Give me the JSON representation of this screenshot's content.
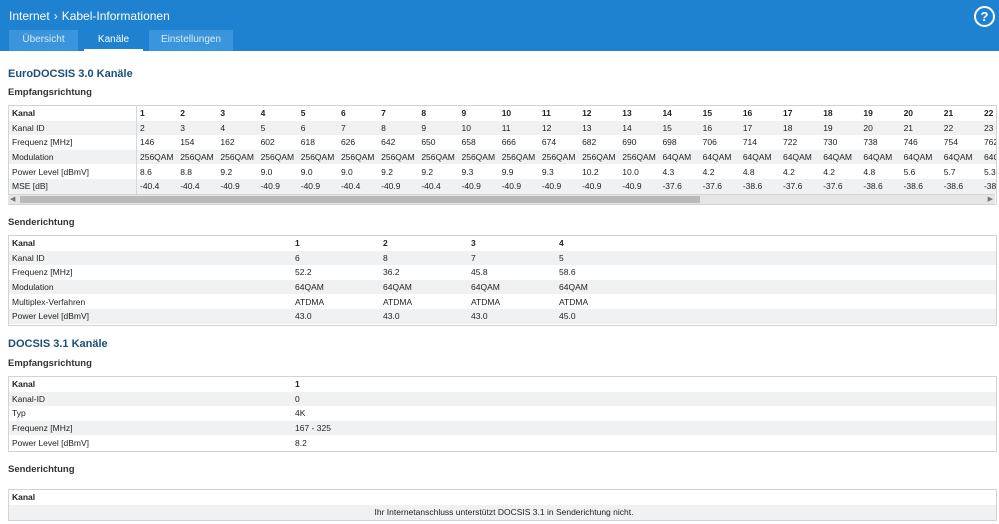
{
  "breadcrumb": {
    "root": "Internet",
    "page": "Kabel-Informationen"
  },
  "help_label": "?",
  "tabs": [
    {
      "label": "Übersicht"
    },
    {
      "label": "Kanäle"
    },
    {
      "label": "Einstellungen"
    }
  ],
  "euro30": {
    "title": "EuroDOCSIS 3.0 Kanäle",
    "down": {
      "title": "Empfangsrichtung",
      "labels": [
        "Kanal",
        "Kanal ID",
        "Frequenz [MHz]",
        "Modulation",
        "Power Level [dBmV]",
        "MSE [dB]"
      ],
      "columns": [
        [
          "1",
          "2",
          "146",
          "256QAM",
          "8.6",
          "-40.4"
        ],
        [
          "2",
          "3",
          "154",
          "256QAM",
          "8.8",
          "-40.4"
        ],
        [
          "3",
          "4",
          "162",
          "256QAM",
          "9.2",
          "-40.9"
        ],
        [
          "4",
          "5",
          "602",
          "256QAM",
          "9.0",
          "-40.9"
        ],
        [
          "5",
          "6",
          "618",
          "256QAM",
          "9.0",
          "-40.9"
        ],
        [
          "6",
          "7",
          "626",
          "256QAM",
          "9.0",
          "-40.4"
        ],
        [
          "7",
          "8",
          "642",
          "256QAM",
          "9.2",
          "-40.9"
        ],
        [
          "8",
          "9",
          "650",
          "256QAM",
          "9.2",
          "-40.4"
        ],
        [
          "9",
          "10",
          "658",
          "256QAM",
          "9.3",
          "-40.9"
        ],
        [
          "10",
          "11",
          "666",
          "256QAM",
          "9.9",
          "-40.9"
        ],
        [
          "11",
          "12",
          "674",
          "256QAM",
          "9.3",
          "-40.9"
        ],
        [
          "12",
          "13",
          "682",
          "256QAM",
          "10.2",
          "-40.9"
        ],
        [
          "13",
          "14",
          "690",
          "256QAM",
          "10.0",
          "-40.9"
        ],
        [
          "14",
          "15",
          "698",
          "64QAM",
          "4.3",
          "-37.6"
        ],
        [
          "15",
          "16",
          "706",
          "64QAM",
          "4.2",
          "-37.6"
        ],
        [
          "16",
          "17",
          "714",
          "64QAM",
          "4.8",
          "-38.6"
        ],
        [
          "17",
          "18",
          "722",
          "64QAM",
          "4.2",
          "-37.6"
        ],
        [
          "18",
          "19",
          "730",
          "64QAM",
          "4.2",
          "-37.6"
        ],
        [
          "19",
          "20",
          "738",
          "64QAM",
          "4.8",
          "-38.6"
        ],
        [
          "20",
          "21",
          "746",
          "64QAM",
          "5.6",
          "-38.6"
        ],
        [
          "21",
          "22",
          "754",
          "64QAM",
          "5.7",
          "-38.6"
        ],
        [
          "22",
          "23",
          "762",
          "64Q",
          "5.3",
          "-38."
        ]
      ]
    },
    "up": {
      "title": "Senderichtung",
      "labels": [
        "Kanal",
        "Kanal ID",
        "Frequenz [MHz]",
        "Modulation",
        "Multiplex-Verfahren",
        "Power Level [dBmV]"
      ],
      "columns": [
        [
          "1",
          "6",
          "52.2",
          "64QAM",
          "ATDMA",
          "43.0"
        ],
        [
          "2",
          "8",
          "36.2",
          "64QAM",
          "ATDMA",
          "43.0"
        ],
        [
          "3",
          "7",
          "45.8",
          "64QAM",
          "ATDMA",
          "43.0"
        ],
        [
          "4",
          "5",
          "58.6",
          "64QAM",
          "ATDMA",
          "45.0"
        ]
      ]
    }
  },
  "d31": {
    "title": "DOCSIS 3.1 Kanäle",
    "down": {
      "title": "Empfangsrichtung",
      "labels": [
        "Kanal",
        "Kanal-ID",
        "Typ",
        "Frequenz [MHz]",
        "Power Level [dBmV]"
      ],
      "columns": [
        [
          "1",
          "0",
          "4K",
          "167 - 325",
          "8.2"
        ]
      ]
    },
    "up": {
      "title": "Senderichtung",
      "header": "Kanal",
      "message": "Ihr Internetanschluss unterstützt DOCSIS 3.1 in Senderichtung nicht."
    }
  },
  "colors": {
    "topbar": "#1f82d1",
    "heading": "#1a4f7a"
  }
}
